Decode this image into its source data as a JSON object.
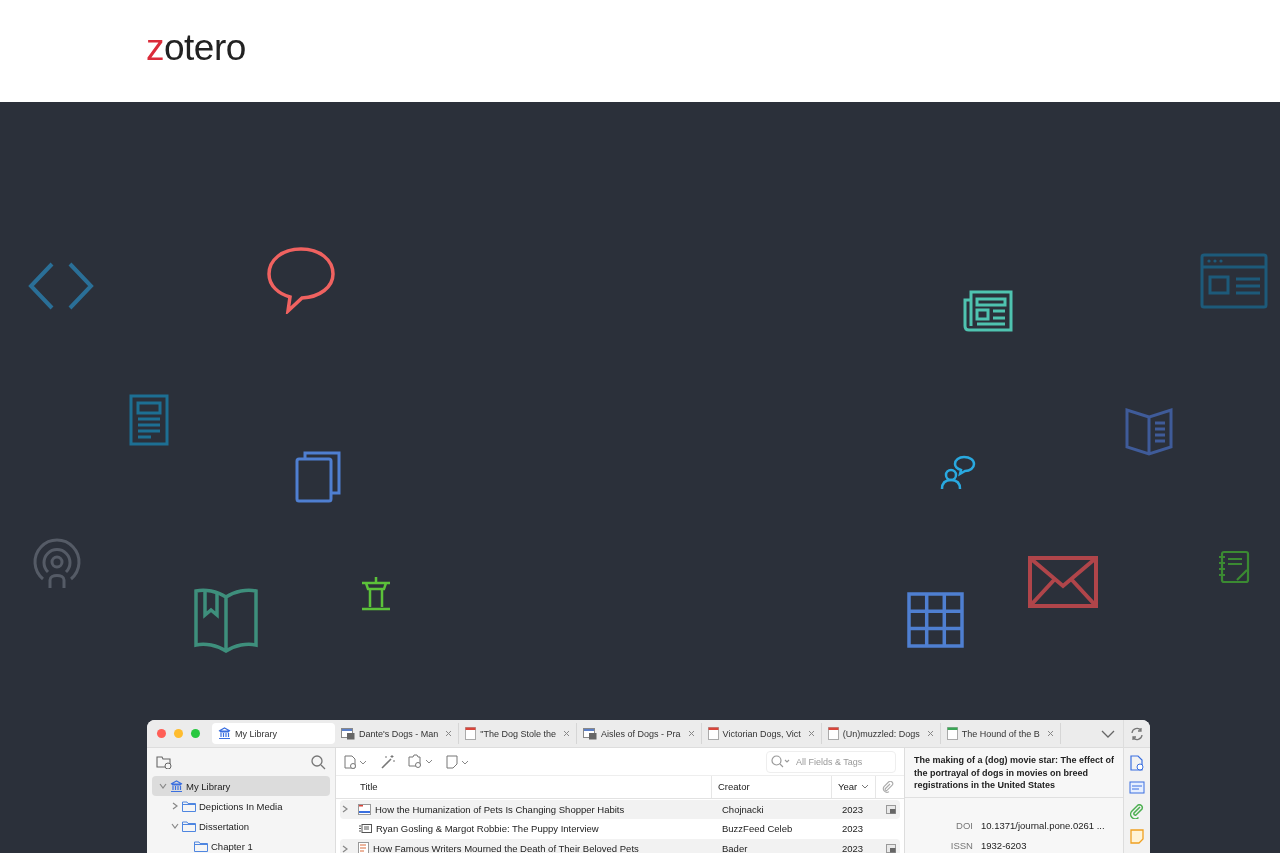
{
  "logo": {
    "initial": "z",
    "rest": "otero"
  },
  "window": {
    "tabs": [
      {
        "label": "My Library",
        "kind": "library",
        "selected": true
      },
      {
        "label": "Dante's Dogs - Man",
        "kind": "webpage",
        "selected": false
      },
      {
        "label": "\"The Dog Stole the",
        "kind": "pdf",
        "selected": false
      },
      {
        "label": "Aisles of Dogs - Pra",
        "kind": "webpage",
        "selected": false
      },
      {
        "label": "Victorian Dogs, Vict",
        "kind": "pdf",
        "selected": false
      },
      {
        "label": "(Un)muzzled: Dogs",
        "kind": "pdf",
        "selected": false
      },
      {
        "label": "The Hound of the B",
        "kind": "epub",
        "selected": false
      }
    ],
    "collections": [
      {
        "label": "My Library",
        "kind": "library",
        "expanded": true,
        "selected": true,
        "children": [
          {
            "label": "Depictions In Media",
            "kind": "folder",
            "expanded": false,
            "selected": false
          },
          {
            "label": "Dissertation",
            "kind": "folder",
            "expanded": true,
            "selected": false,
            "children": [
              {
                "label": "Chapter 1",
                "kind": "folder",
                "selected": false
              }
            ]
          }
        ]
      }
    ],
    "search": {
      "placeholder": "All Fields & Tags"
    },
    "columns": [
      {
        "label": "Title",
        "sorted": false
      },
      {
        "label": "Creator",
        "sorted": false
      },
      {
        "label": "Year",
        "sorted": true
      }
    ],
    "items": [
      {
        "title": "How the Humanization of Pets Is Changing Shopper Habits",
        "creator": "Chojnacki",
        "year": "2023",
        "kind": "article",
        "expandable": true,
        "attachment": true
      },
      {
        "title": "Ryan Gosling & Margot Robbie: The Puppy Interview",
        "creator": "BuzzFeed Celeb",
        "year": "2023",
        "kind": "video",
        "expandable": false,
        "attachment": false
      },
      {
        "title": "How Famous Writers Mourned the Death of Their Beloved Pets",
        "creator": "Bader",
        "year": "2023",
        "kind": "book",
        "expandable": true,
        "attachment": true
      }
    ],
    "item_pane": {
      "title": "The making of a (dog) movie star: The effect of the portrayal of dogs in movies on breed registrations in the United States",
      "fields": [
        {
          "label": "DOI",
          "value": "10.1371/journal.pone.0261 ..."
        },
        {
          "label": "ISSN",
          "value": "1932-6203"
        }
      ]
    }
  }
}
